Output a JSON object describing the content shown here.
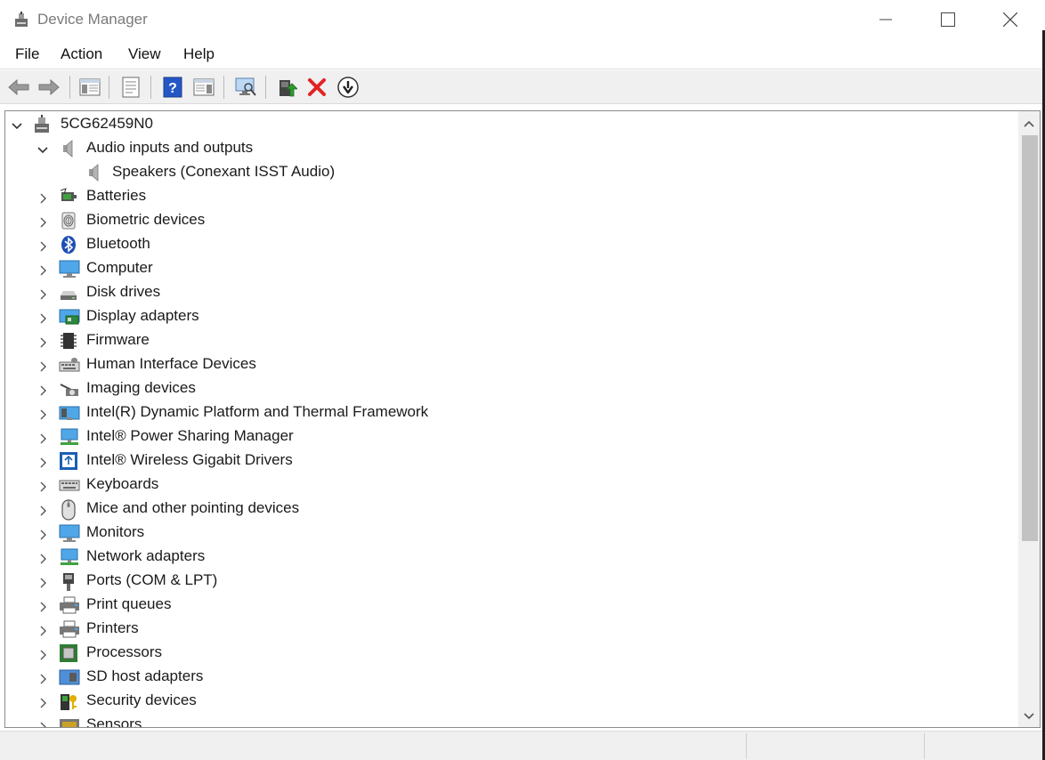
{
  "window": {
    "title": "Device Manager",
    "controls": [
      "minimize",
      "maximize",
      "close"
    ]
  },
  "menu": [
    "File",
    "Action",
    "View",
    "Help"
  ],
  "toolbar": {
    "buttons": [
      "back-icon",
      "forward-icon",
      "show-hide-console-tree-icon",
      "properties-icon",
      "help-icon",
      "action-pane-icon",
      "scan-hardware-changes-icon",
      "update-driver-icon",
      "uninstall-device-icon",
      "disable-device-icon"
    ],
    "accent_colors": {
      "help": "#2457c5",
      "uninstall": "#e22323",
      "update": "#2e8b2e"
    }
  },
  "tree": {
    "root": "5CG62459N0",
    "audio": {
      "label": "Audio inputs and outputs",
      "children": [
        "Speakers (Conexant ISST Audio)"
      ]
    },
    "categories": [
      "Batteries",
      "Biometric devices",
      "Bluetooth",
      "Computer",
      "Disk drives",
      "Display adapters",
      "Firmware",
      "Human Interface Devices",
      "Imaging devices",
      "Intel(R) Dynamic Platform and Thermal Framework",
      "Intel® Power Sharing Manager",
      "Intel® Wireless Gigabit Drivers",
      "Keyboards",
      "Mice and other pointing devices",
      "Monitors",
      "Network adapters",
      "Ports (COM & LPT)",
      "Print queues",
      "Printers",
      "Processors",
      "SD host adapters",
      "Security devices",
      "Sensors"
    ]
  }
}
